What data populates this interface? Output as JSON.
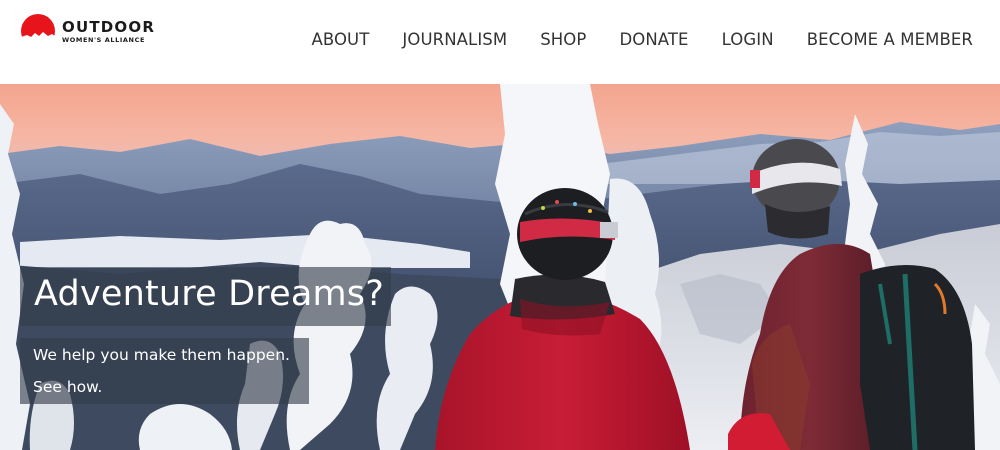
{
  "brand": {
    "name_line1": "OUTDOOR",
    "name_line2": "WOMEN'S ALLIANCE",
    "logo_color": "#e8141c"
  },
  "nav": {
    "items": [
      {
        "label": "ABOUT"
      },
      {
        "label": "JOURNALISM"
      },
      {
        "label": "SHOP"
      },
      {
        "label": "DONATE"
      },
      {
        "label": "LOGIN"
      },
      {
        "label": "BECOME A MEMBER"
      }
    ]
  },
  "hero": {
    "headline": "Adventure Dreams?",
    "subtext_line1": "We help you make them happen.",
    "subtext_line2": "See how.",
    "image_icon": "mountain-skiers-photo"
  }
}
